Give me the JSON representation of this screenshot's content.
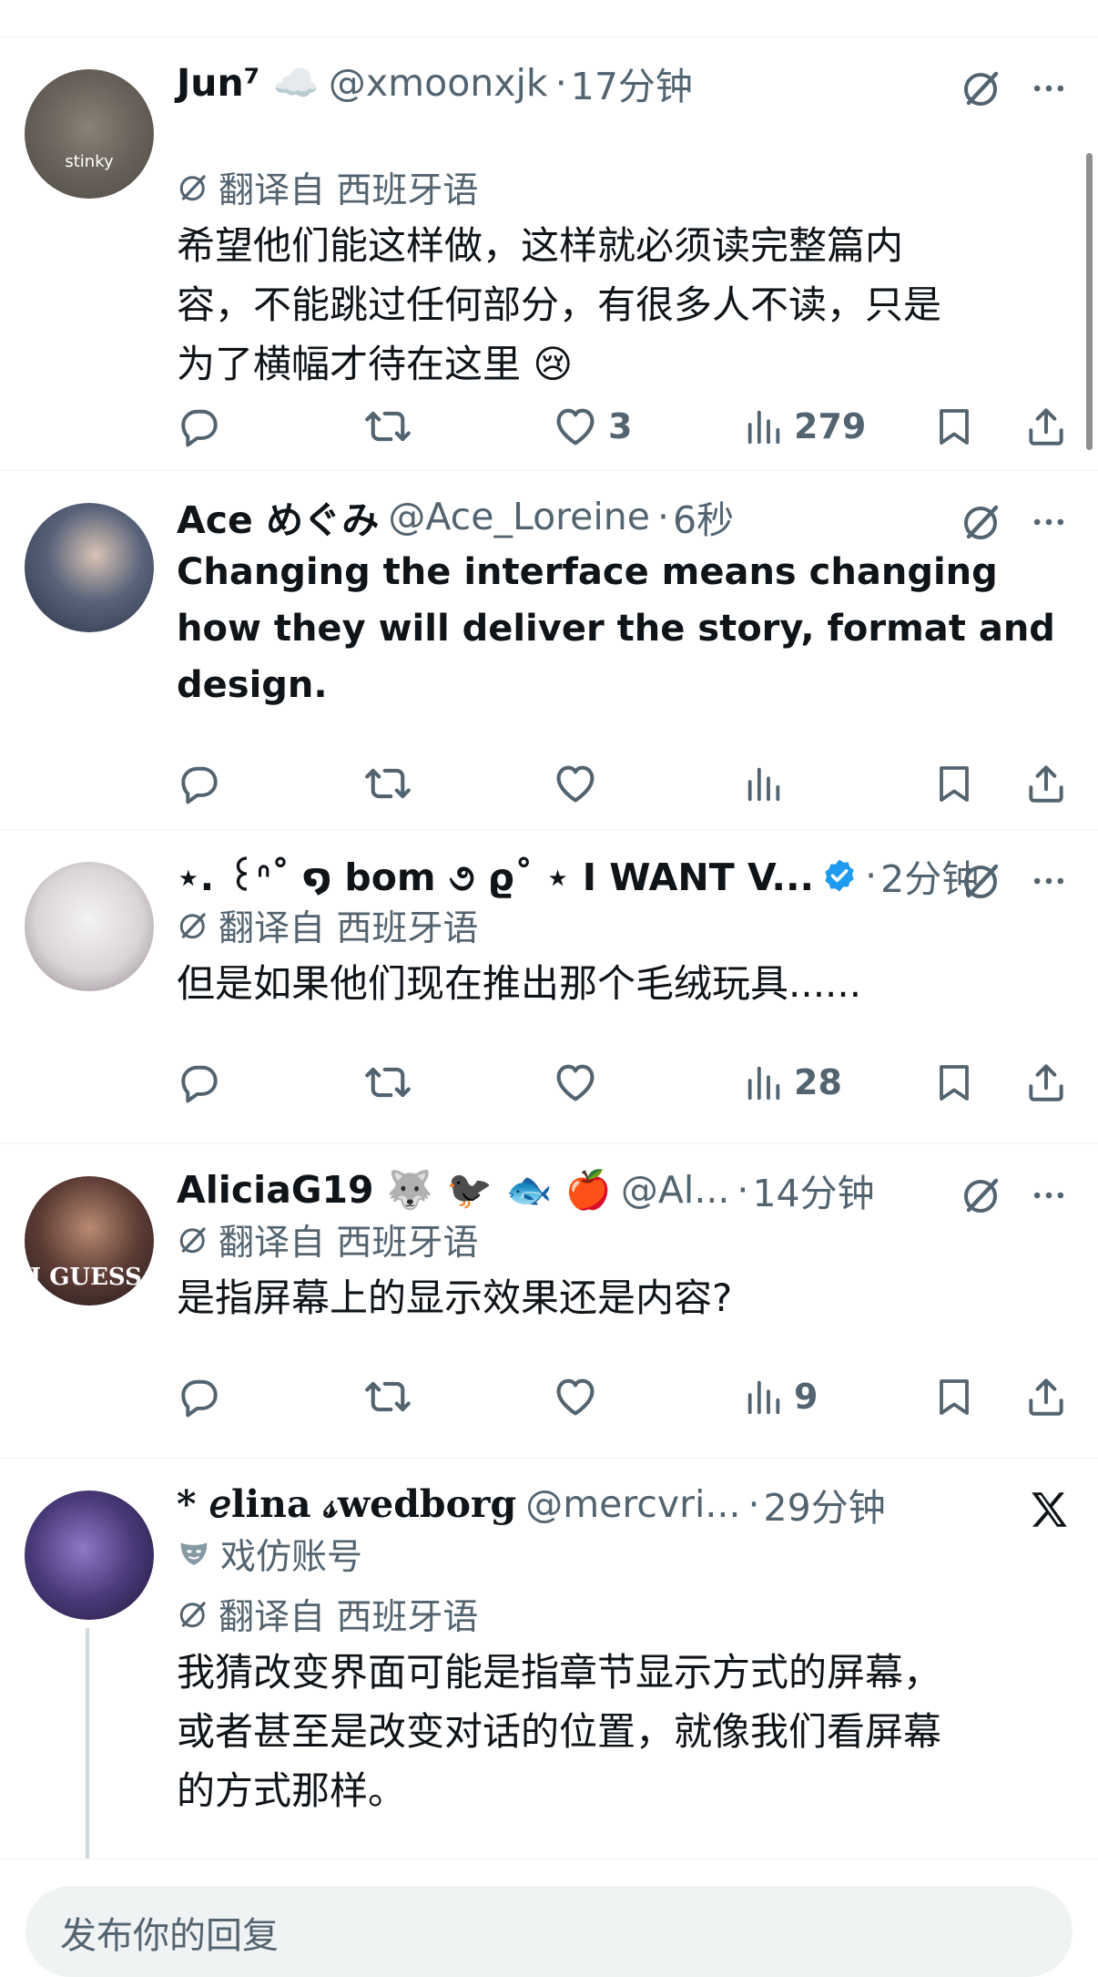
{
  "tweets": [
    {
      "name": "Jun⁷ ☁️",
      "handle": "@xmoonxjk",
      "time": "17分钟",
      "translated_label": "翻译自 西班牙语",
      "avatar_caption": "stinky",
      "text_lines": [
        "希望他们能这样做，这样就必须读完整篇内",
        "容，不能跳过任何部分，有很多人不读，只是",
        "为了横幅才待在这里 😢"
      ],
      "likes": "3",
      "views": "279"
    },
    {
      "name": "Ace めぐみ",
      "handle": "@Ace_Loreine",
      "time": "6秒",
      "text_lines": [
        "Changing the interface means changing",
        "how they will deliver the story, format and",
        "design."
      ]
    },
    {
      "name": "⋆. ꒰ᐢ˚ ໑ bom ૭ ϱ˚ ⋆ I WANT V...",
      "time": "2分钟",
      "translated_label": "翻译自 西班牙语",
      "text_lines": [
        "但是如果他们现在推出那个毛绒玩具......"
      ],
      "views": "28"
    },
    {
      "name": "AliciaG19 🐺 🐦‍⬛ 🐟 🍎",
      "handle": "@Al...",
      "time": "14分钟",
      "translated_label": "翻译自 西班牙语",
      "avatar_caption": "I GUESS",
      "text_lines": [
        "是指屏幕上的显示效果还是内容?"
      ],
      "views": "9"
    },
    {
      "name": "* 𝑒lina 𝓈wedborg",
      "handle": "@mercvri...",
      "time": "29分钟",
      "parody_label": "戏仿账号",
      "translated_label": "翻译自 西班牙语",
      "text_lines": [
        "我猜改变界面可能是指章节显示方式的屏幕，",
        "或者甚至是改变对话的位置，就像我们看屏幕",
        "的方式那样。"
      ]
    }
  ],
  "separator": "·",
  "reply_bar": {
    "placeholder": "发布你的回复"
  },
  "colors": {
    "secondary_text": "#536471",
    "primary_text": "#0f1419",
    "verified_blue": "#1d9bf0",
    "divider": "#eff3f4"
  },
  "icons": [
    "reply-icon",
    "retweet-icon",
    "like-icon",
    "views-icon",
    "bookmark-icon",
    "share-icon",
    "grok-icon",
    "more-icon",
    "x-logo-icon",
    "verified-badge-icon",
    "mask-icon"
  ]
}
